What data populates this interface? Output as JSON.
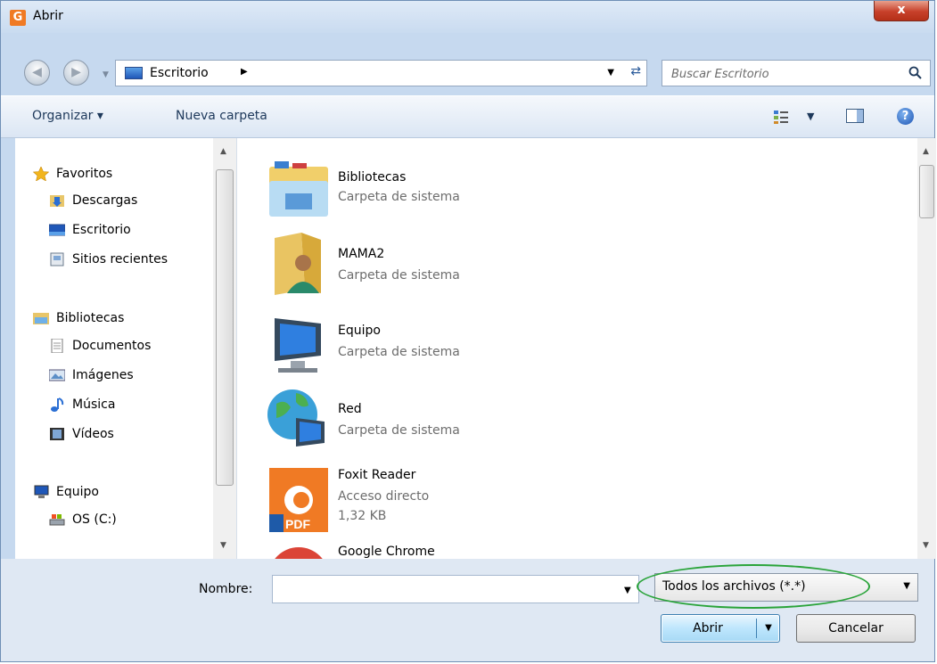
{
  "window": {
    "title": "Abrir",
    "close_label": "x",
    "app_icon_glyph": "G"
  },
  "address": {
    "path_label": "Escritorio",
    "search_placeholder": "Buscar Escritorio"
  },
  "toolbar": {
    "organize_label": "Organizar ▾",
    "new_folder_label": "Nueva carpeta"
  },
  "sidebar": {
    "groups": [
      {
        "label": "Favoritos",
        "icon": "star-icon",
        "items": [
          {
            "label": "Descargas",
            "icon": "downloads-folder-icon"
          },
          {
            "label": "Escritorio",
            "icon": "desktop-icon"
          },
          {
            "label": "Sitios recientes",
            "icon": "recent-places-icon"
          }
        ]
      },
      {
        "label": "Bibliotecas",
        "icon": "libraries-icon",
        "items": [
          {
            "label": "Documentos",
            "icon": "documents-icon"
          },
          {
            "label": "Imágenes",
            "icon": "pictures-icon"
          },
          {
            "label": "Música",
            "icon": "music-icon"
          },
          {
            "label": "Vídeos",
            "icon": "videos-icon"
          }
        ]
      },
      {
        "label": "Equipo",
        "icon": "computer-icon",
        "items": [
          {
            "label": "OS (C:)",
            "icon": "drive-icon"
          }
        ]
      }
    ]
  },
  "files": [
    {
      "name": "Bibliotecas",
      "type": "Carpeta de sistema",
      "icon": "libraries-folder-icon"
    },
    {
      "name": "MAMA2",
      "type": "Carpeta de sistema",
      "icon": "user-folder-icon"
    },
    {
      "name": "Equipo",
      "type": "Carpeta de sistema",
      "icon": "computer-icon"
    },
    {
      "name": "Red",
      "type": "Carpeta de sistema",
      "icon": "network-icon"
    },
    {
      "name": "Foxit Reader",
      "type": "Acceso directo",
      "size": "1,32 KB",
      "icon": "foxit-pdf-icon",
      "badge": "PDF"
    },
    {
      "name": "Google Chrome",
      "type": "",
      "icon": "chrome-icon"
    }
  ],
  "footer": {
    "name_label": "Nombre:",
    "name_value": "",
    "filetype_value": "Todos los archivos (*.*)",
    "open_label": "Abrir",
    "cancel_label": "Cancelar"
  },
  "colors": {
    "highlight_ellipse": "#2aa43a",
    "accent": "#1e395b"
  }
}
